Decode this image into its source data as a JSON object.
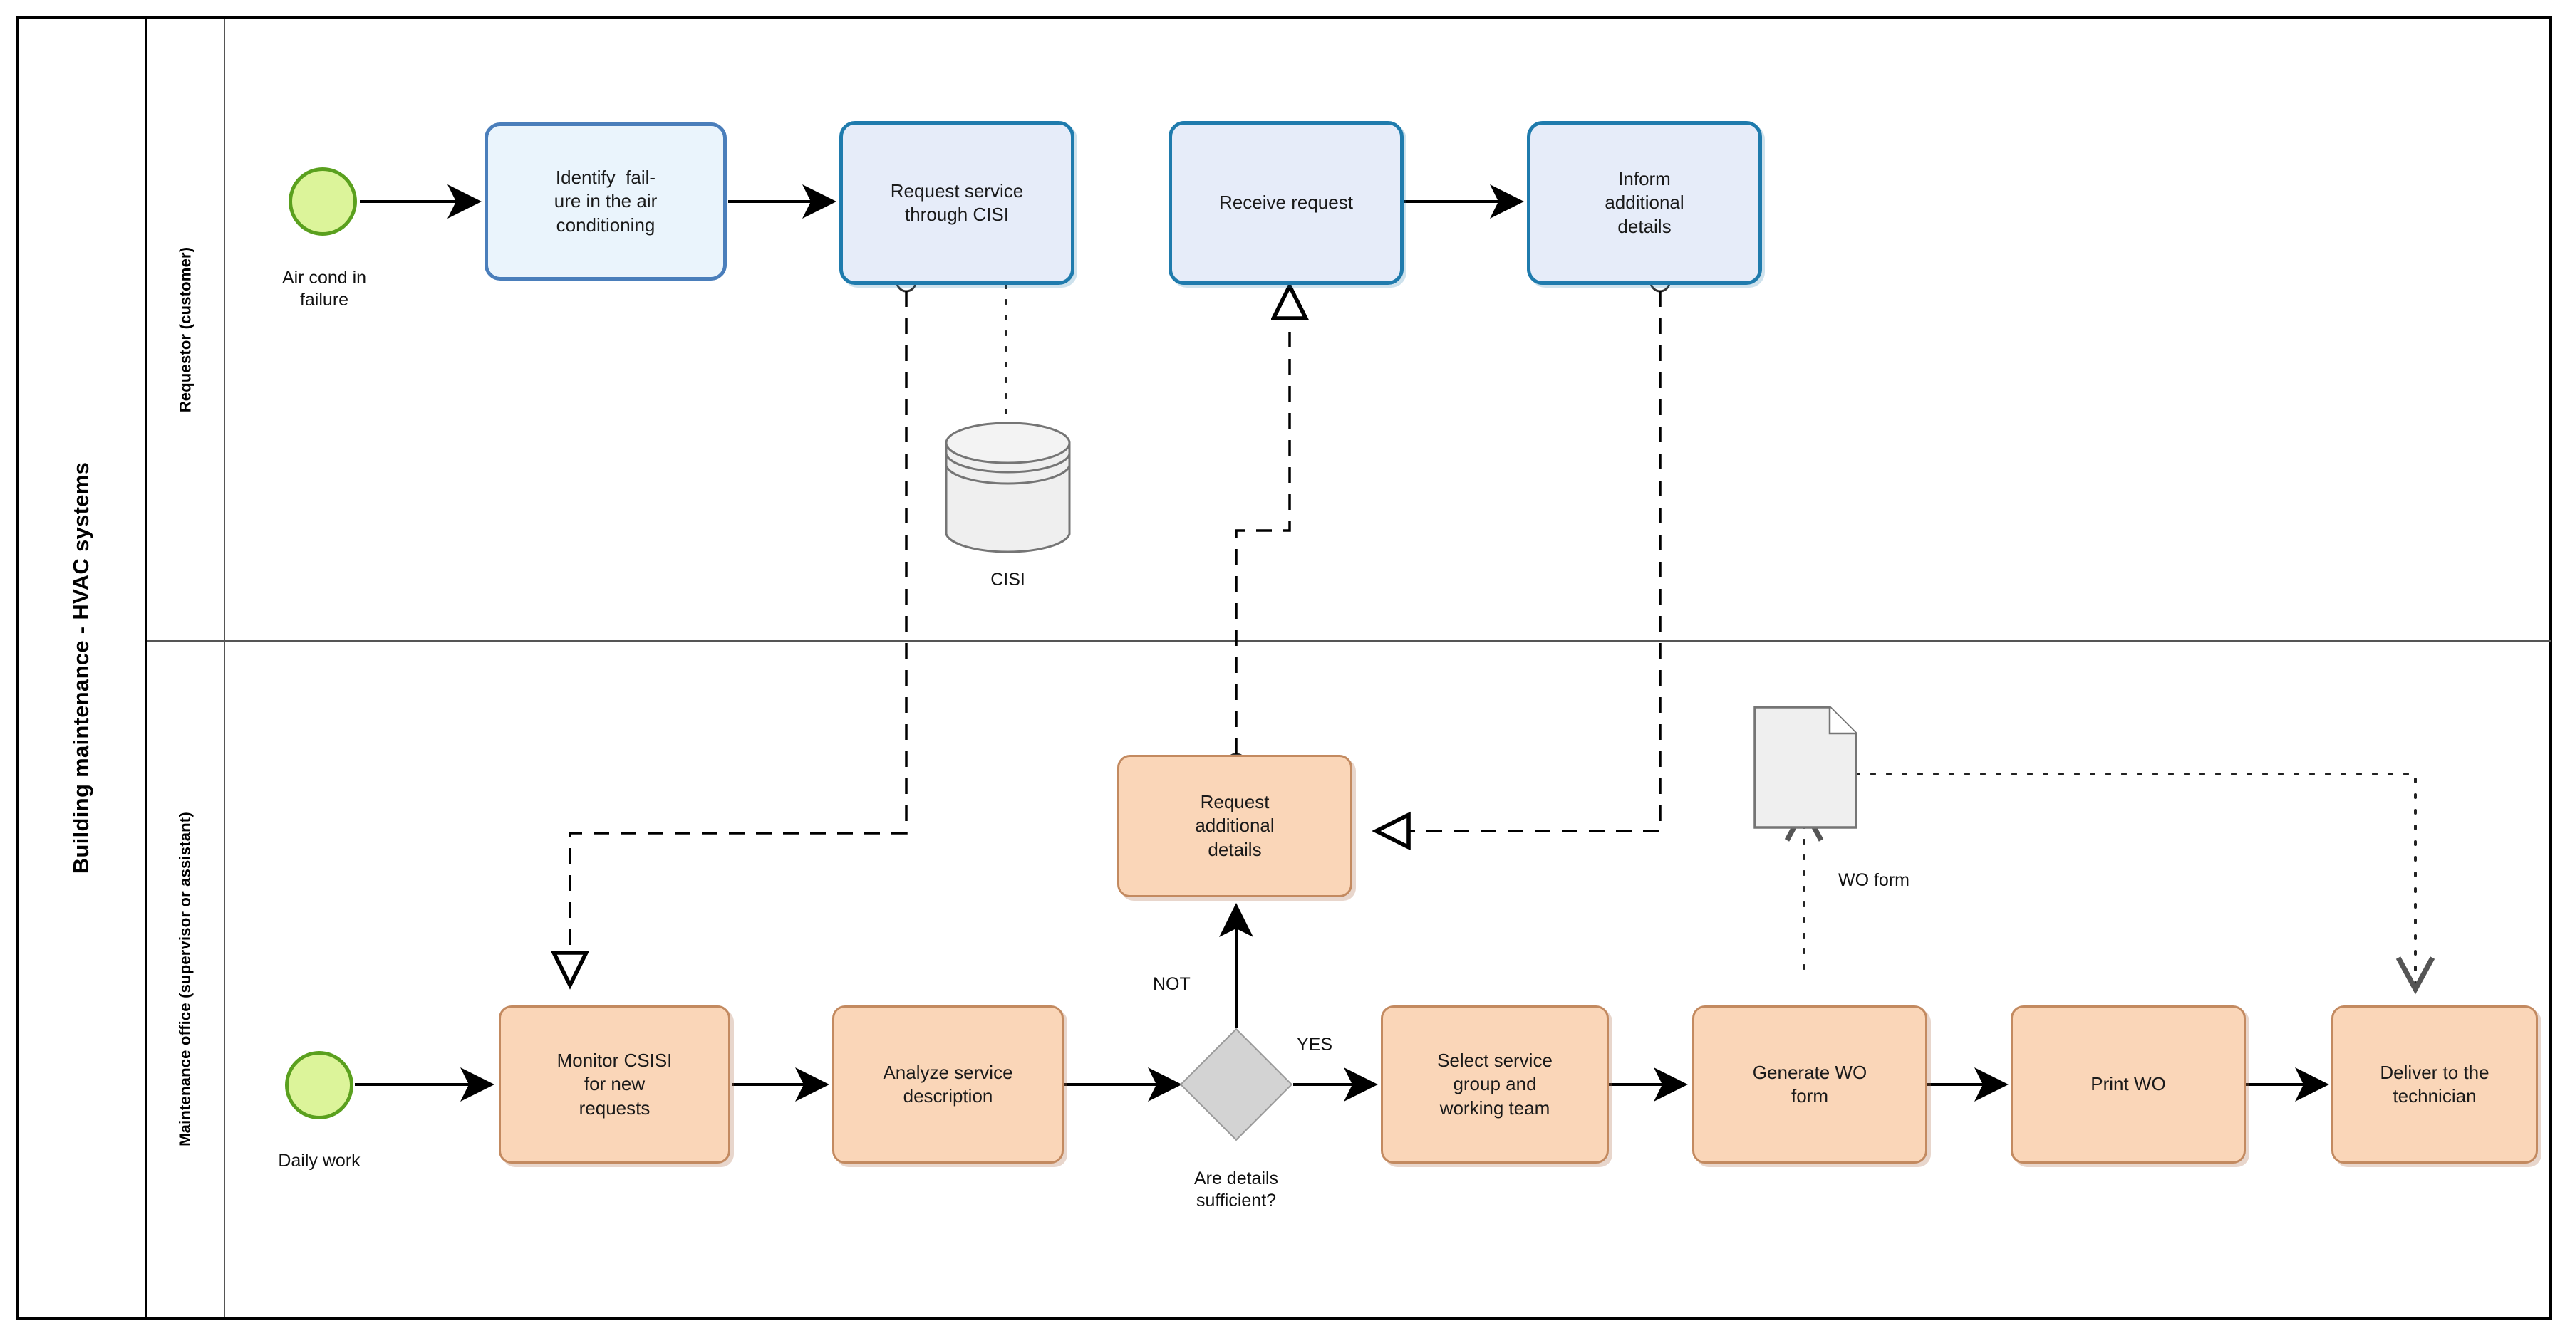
{
  "diagram": {
    "type": "bpmn-collaboration-diagram",
    "pool_title": "Building maintenance - HVAC systems",
    "lanes": [
      {
        "id": "lane-requestor",
        "label": "Requestor (customer)"
      },
      {
        "id": "lane-maintenance",
        "label": "Maintenance office (supervisor or assistant)"
      }
    ]
  },
  "events": [
    {
      "id": "start-air-cond",
      "label": "Air cond in\nfailure",
      "lane": "lane-requestor",
      "type": "start"
    },
    {
      "id": "start-daily-work",
      "label": "Daily work",
      "lane": "lane-maintenance",
      "type": "start"
    }
  ],
  "tasks": {
    "identify_failure": "Identify  fail-\nure in the air\nconditioning",
    "request_service": "Request service\nthrough CISI",
    "receive_request": "Receive request",
    "inform_details": "Inform\nadditional\ndetails",
    "request_add_details": "Request\nadditional\ndetails",
    "monitor_csisi": "Monitor CSISI\nfor new\nrequests",
    "analyze_service": "Analyze service\ndescription",
    "select_group": "Select service\ngroup and\nworking team",
    "generate_wo": "Generate WO\nform",
    "print_wo": "Print  WO",
    "deliver_tech": "Deliver to the\ntechnician"
  },
  "gateway": {
    "id": "gw-details-sufficient",
    "label": "Are details\nsufficient?",
    "type": "exclusive",
    "outgoing": [
      {
        "label": "NOT",
        "direction": "up",
        "target": "request_add_details"
      },
      {
        "label": "YES",
        "direction": "right",
        "target": "select_group"
      }
    ]
  },
  "artifacts": [
    {
      "id": "datastore-cisi",
      "type": "data-store",
      "label": "CISI"
    },
    {
      "id": "doc-wo-form",
      "type": "data-object",
      "label": "WO form"
    }
  ],
  "colors": {
    "task_blue_light_fill": "#eaf4fc",
    "task_blue_light_stroke": "#4a7ebb",
    "task_blue_dark_fill": "#e6ecf9",
    "task_blue_dark_stroke": "#1f7bad",
    "task_orange_fill": "#fad6b8",
    "task_orange_stroke": "#c38a60",
    "start_event_fill": "#dcf49a",
    "start_event_stroke": "#5aa01e",
    "gateway_fill": "#d3d3d3",
    "gateway_stroke": "#9a9a9a",
    "artifact_fill": "#efefef",
    "artifact_stroke": "#757575",
    "pool_border": "#000000",
    "lane_border": "#555555"
  }
}
